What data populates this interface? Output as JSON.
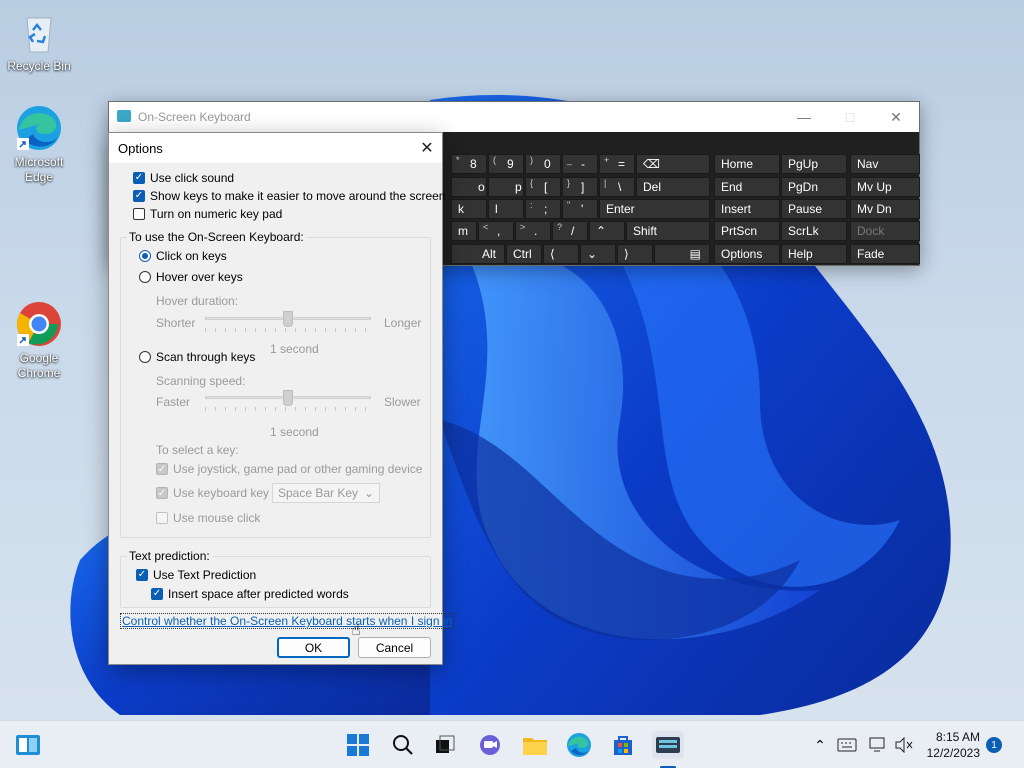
{
  "desktop": {
    "icons": [
      {
        "label": "Recycle Bin"
      },
      {
        "label": "Microsoft Edge"
      },
      {
        "label": "Google Chrome"
      }
    ]
  },
  "osk": {
    "title": "On-Screen Keyboard",
    "keys": {
      "r1": [
        "8",
        "9",
        "0",
        "-",
        "=",
        "Home",
        "PgUp",
        "Nav"
      ],
      "r1_sub": [
        "*",
        "(",
        ")",
        "_",
        "+"
      ],
      "r2": [
        "o",
        "p",
        "[",
        "]",
        "\\",
        "Del",
        "End",
        "PgDn",
        "Mv Up"
      ],
      "r2_sub": [
        "{",
        "}",
        "|"
      ],
      "r3": [
        "k",
        "l",
        ";",
        "'",
        "Enter",
        "Insert",
        "Pause",
        "Mv Dn",
        "Dock"
      ],
      "r3_sub": [
        ":",
        "\""
      ],
      "r4": [
        "m",
        ",",
        ".",
        "/",
        "Shift",
        "PrtScn",
        "ScrLk"
      ],
      "r4_sub": [
        "<",
        ">",
        "?"
      ],
      "r5": [
        "Alt",
        "Ctrl",
        "Options",
        "Help",
        "Fade"
      ]
    }
  },
  "dialog": {
    "title": "Options",
    "options": {
      "click_sound": "Use click sound",
      "show_keys": "Show keys to make it easier to move around the screen",
      "numeric_pad": "Turn on numeric key pad"
    },
    "use_group": {
      "label": "To use the On-Screen Keyboard:",
      "click_on_keys": "Click on keys",
      "hover_over_keys": "Hover over keys",
      "hover_duration": "Hover duration:",
      "shorter": "Shorter",
      "longer": "Longer",
      "hover_value": "1 second",
      "hover_level": 0.5,
      "scan_through_keys": "Scan through keys",
      "scanning_speed": "Scanning speed:",
      "faster": "Faster",
      "slower": "Slower",
      "scan_value": "1 second",
      "scan_level": 0.5,
      "to_select": "To select a key:",
      "joystick": "Use joystick, game pad or other gaming device",
      "keyboard_key": "Use keyboard key",
      "keyboard_key_value": "Space Bar Key",
      "mouse_click": "Use mouse click"
    },
    "prediction": {
      "label": "Text prediction:",
      "use": "Use Text Prediction",
      "insert_space": "Insert space after predicted words"
    },
    "link": "Control whether the On-Screen Keyboard starts when I sign in",
    "ok": "OK",
    "cancel": "Cancel"
  },
  "taskbar": {
    "time": "8:15 AM",
    "date": "12/2/2023",
    "notifications": "1"
  }
}
